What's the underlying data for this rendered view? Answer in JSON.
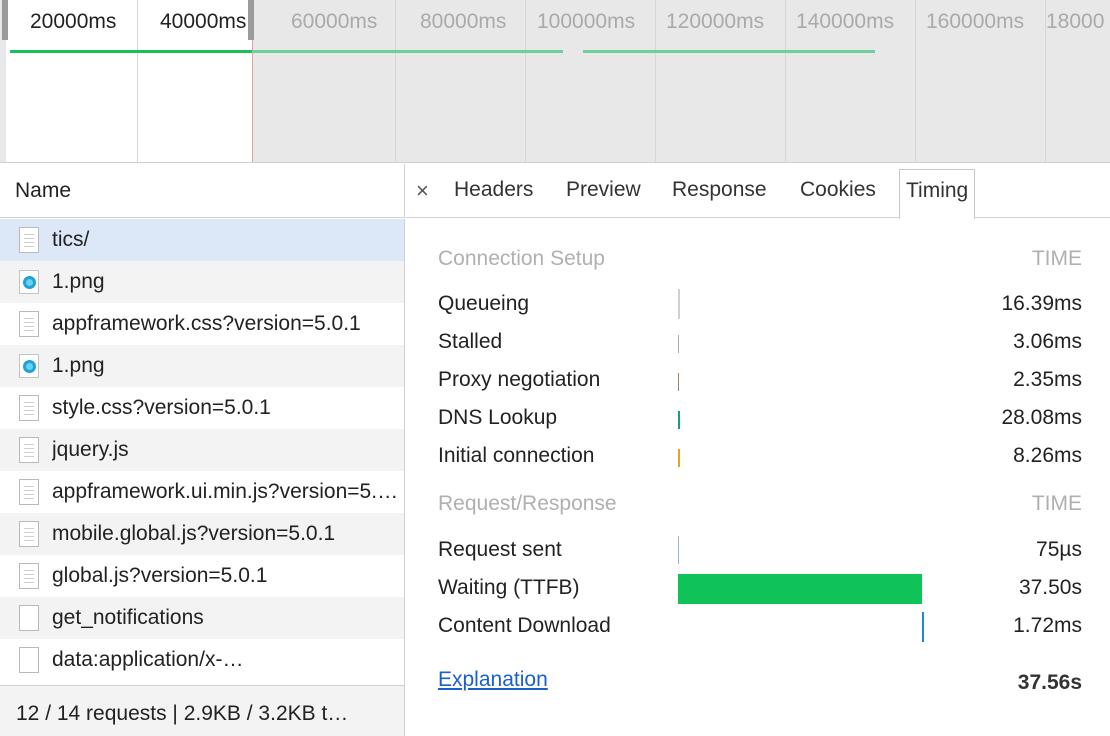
{
  "overview": {
    "ticks": [
      "20000ms",
      "40000ms",
      "60000ms",
      "80000ms",
      "100000ms",
      "120000ms",
      "140000ms",
      "160000ms",
      "18000"
    ]
  },
  "list": {
    "column_header": "Name",
    "rows": [
      {
        "name": "tics/",
        "icon": "document-icon"
      },
      {
        "name": "1.png",
        "icon": "image-icon"
      },
      {
        "name": "appframework.css?version=5.0.1",
        "icon": "document-icon"
      },
      {
        "name": "1.png",
        "icon": "image-icon"
      },
      {
        "name": "style.css?version=5.0.1",
        "icon": "document-icon"
      },
      {
        "name": "jquery.js",
        "icon": "document-icon"
      },
      {
        "name": "appframework.ui.min.js?version=5.0.1",
        "icon": "document-icon"
      },
      {
        "name": "mobile.global.js?version=5.0.1",
        "icon": "document-icon"
      },
      {
        "name": "global.js?version=5.0.1",
        "icon": "document-icon"
      },
      {
        "name": "get_notifications",
        "icon": "blank-file-icon"
      },
      {
        "name": "data:application/x-…",
        "icon": "blank-file-icon"
      }
    ],
    "status": "12 / 14 requests | 2.9KB / 3.2KB t…"
  },
  "tabs": {
    "close": "×",
    "items": [
      "Headers",
      "Preview",
      "Response",
      "Cookies",
      "Timing"
    ],
    "active": "Timing"
  },
  "timing": {
    "connection_setup": {
      "title": "Connection Setup",
      "time_header": "TIME",
      "rows": [
        {
          "label": "Queueing",
          "value": "16.39ms",
          "color": "#d0d0d0"
        },
        {
          "label": "Stalled",
          "value": "3.06ms",
          "color": "#a8a8a8"
        },
        {
          "label": "Proxy negotiation",
          "value": "2.35ms",
          "color": "#a0826d"
        },
        {
          "label": "DNS Lookup",
          "value": "28.08ms",
          "color": "#1aa06b"
        },
        {
          "label": "Initial connection",
          "value": "8.26ms",
          "color": "#f0a020"
        }
      ]
    },
    "request_response": {
      "title": "Request/Response",
      "time_header": "TIME",
      "rows": [
        {
          "label": "Request sent",
          "value": "75µs",
          "color": "#9ab6c8"
        },
        {
          "label": "Waiting (TTFB)",
          "value": "37.50s",
          "color": "#0fc358"
        },
        {
          "label": "Content Download",
          "value": "1.72ms",
          "color": "#1e88d8"
        }
      ]
    },
    "explanation": "Explanation",
    "total": "37.56s"
  }
}
